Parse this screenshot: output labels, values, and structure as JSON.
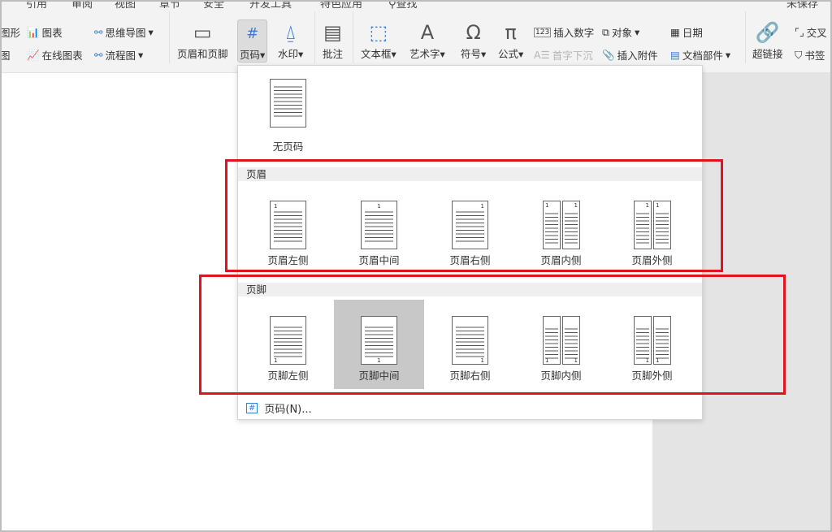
{
  "top_tabs": [
    "引用",
    "审阅",
    "视图",
    "章节",
    "安全",
    "开发工具",
    "特色应用",
    "查找",
    "未保存"
  ],
  "ribbon": {
    "small": [
      {
        "label": "图形",
        "icon": "shape-icon"
      },
      {
        "label": "图表",
        "icon": "chart-icon"
      },
      {
        "label": "思维导图",
        "icon": "mindmap-icon",
        "dropdown": true
      },
      {
        "label": "图",
        "icon": "image-icon"
      },
      {
        "label": "在线图表",
        "icon": "online-chart-icon"
      },
      {
        "label": "流程图",
        "icon": "flowchart-icon",
        "dropdown": true
      },
      {
        "label": "插入数字",
        "icon": "number-icon"
      },
      {
        "label": "对象",
        "icon": "object-icon",
        "dropdown": true
      },
      {
        "label": "日期",
        "icon": "calendar-icon"
      },
      {
        "label": "首字下沉",
        "icon": "dropcap-icon",
        "disabled": true
      },
      {
        "label": "插入附件",
        "icon": "paperclip-icon"
      },
      {
        "label": "文档部件",
        "icon": "docpart-icon",
        "dropdown": true
      },
      {
        "label": "交叉",
        "icon": "crossref-icon"
      },
      {
        "label": "书签",
        "icon": "bookmark-icon"
      }
    ],
    "big": [
      {
        "label": "页眉和页脚",
        "icon": "header-footer-icon"
      },
      {
        "label": "页码",
        "icon": "page-number-icon",
        "dropdown": true,
        "active": true
      },
      {
        "label": "水印",
        "icon": "watermark-icon",
        "dropdown": true
      },
      {
        "label": "批注",
        "icon": "comment-icon"
      },
      {
        "label": "文本框",
        "icon": "textbox-icon",
        "dropdown": true
      },
      {
        "label": "艺术字",
        "icon": "wordart-icon",
        "dropdown": true
      },
      {
        "label": "符号",
        "icon": "omega-icon",
        "dropdown": true
      },
      {
        "label": "公式",
        "icon": "pi-icon",
        "dropdown": true
      },
      {
        "label": "超链接",
        "icon": "link-icon"
      }
    ]
  },
  "menu": {
    "none": {
      "label": "无页码",
      "type": "none"
    },
    "header_section": "页眉",
    "header_items": [
      {
        "label": "页眉左侧",
        "type": "tl"
      },
      {
        "label": "页眉中间",
        "type": "tc"
      },
      {
        "label": "页眉右侧",
        "type": "tr"
      },
      {
        "label": "页眉内侧",
        "type": "ti"
      },
      {
        "label": "页眉外侧",
        "type": "to"
      }
    ],
    "footer_section": "页脚",
    "footer_items": [
      {
        "label": "页脚左侧",
        "type": "bl"
      },
      {
        "label": "页脚中间",
        "type": "bc",
        "selected": true
      },
      {
        "label": "页脚右侧",
        "type": "br"
      },
      {
        "label": "页脚内侧",
        "type": "bi"
      },
      {
        "label": "页脚外侧",
        "type": "bo"
      }
    ],
    "page_number_dialog": "页码(N)...",
    "page_number_digit": "1"
  },
  "colors": {
    "highlight_box": "#e0141e",
    "selected_bg": "#c8c8c8"
  }
}
